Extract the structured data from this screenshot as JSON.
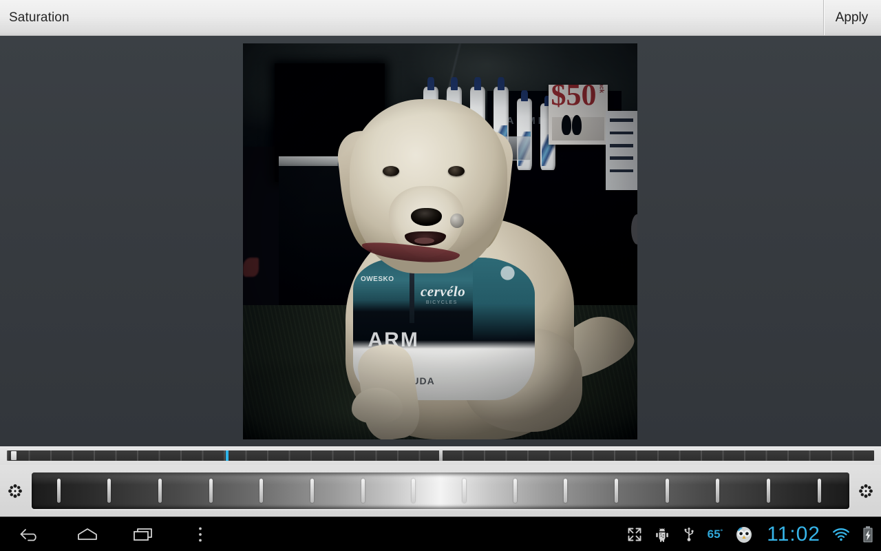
{
  "titlebar": {
    "title": "Saturation",
    "apply_label": "Apply"
  },
  "editor": {
    "left_gear_icon": "settings-gear-icon",
    "right_gear_icon": "settings-gear-icon",
    "slider_name": "saturation-slider",
    "ruler_name": "effect-ruler"
  },
  "photo": {
    "subject": "yellow-labrador-dog-in-cycling-jersey",
    "jersey_brand": "cervélo",
    "jersey_sponsor": "OWESKO",
    "jersey_team": "ARM",
    "jersey_lower": "CUDA",
    "banner_text": "GARMIN",
    "sign_price": "$50",
    "sign_back": "back"
  },
  "navbar": {
    "back_icon": "back-arrow-icon",
    "home_icon": "home-icon",
    "recents_icon": "recent-apps-icon",
    "menu_icon": "overflow-menu-icon",
    "fullscreen_icon": "fullscreen-icon",
    "debug_icon": "android-debug-icon",
    "usb_icon": "usb-icon",
    "owl_icon": "owl-icon",
    "wifi_icon": "wifi-icon",
    "battery_icon": "battery-charging-icon",
    "temperature": "65",
    "temperature_unit": "°",
    "clock": "11:02"
  },
  "colors": {
    "accent_cyan": "#36b4e8",
    "ruler_marker": "#2fb4e9",
    "background": "#373b40",
    "titlebar": "#ececec"
  }
}
